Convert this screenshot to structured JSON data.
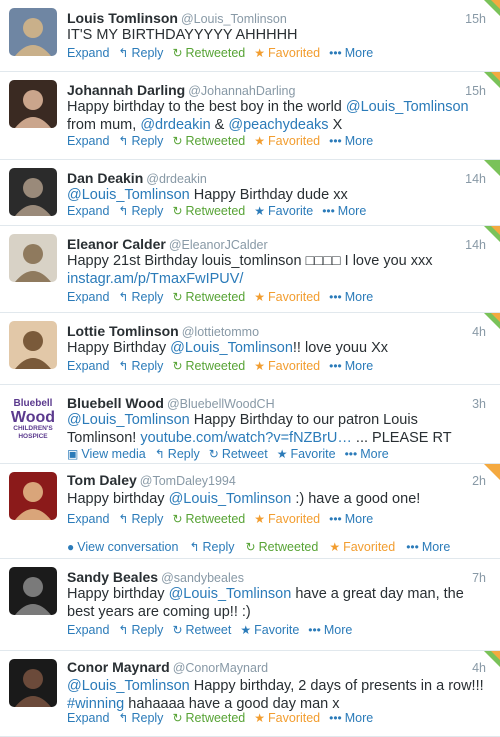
{
  "tweets": [
    {
      "name": "Louis Tomlinson",
      "handle": "@Louis_Tomlinson",
      "time": "15h",
      "text": [
        {
          "t": "IT'S MY BIRTHDAYYYYY AHHHHH"
        }
      ],
      "actions": [
        "Expand",
        "Reply",
        "Retweeted",
        "Favorited",
        "More"
      ],
      "corner": "green-orange"
    },
    {
      "name": "Johannah Darling",
      "handle": "@JohannahDarling",
      "time": "15h",
      "text": [
        {
          "t": "Happy birthday to the best boy in the world "
        },
        {
          "t": "@Louis_Tomlinson",
          "link": true
        },
        {
          "t": " from mum, "
        },
        {
          "t": "@drdeakin",
          "link": true
        },
        {
          "t": " & "
        },
        {
          "t": "@peachydeaks",
          "link": true
        },
        {
          "t": " X"
        }
      ],
      "actions": [
        "Expand",
        "Reply",
        "Retweeted",
        "Favorited",
        "More"
      ],
      "corner": "green-orange"
    },
    {
      "name": "Dan Deakin",
      "handle": "@drdeakin",
      "time": "14h",
      "text": [
        {
          "t": "@Louis_Tomlinson",
          "link": true
        },
        {
          "t": " Happy Birthday dude xx"
        }
      ],
      "actions": [
        "Expand",
        "Reply",
        "Retweeted",
        "Favorite",
        "More"
      ],
      "corner": "green"
    },
    {
      "name": "Eleanor Calder",
      "handle": "@EleanorJCalder",
      "time": "14h",
      "text": [
        {
          "t": "Happy 21st Birthday louis_tomlinson □□□□ I love you xxx "
        },
        {
          "t": "instagr.am/p/TmaxFwIPUV/",
          "link": true
        }
      ],
      "actions": [
        "Expand",
        "Reply",
        "Retweeted",
        "Favorited",
        "More"
      ],
      "corner": "green-orange"
    },
    {
      "name": "Lottie Tomlinson",
      "handle": "@lottietommo",
      "time": "4h",
      "text": [
        {
          "t": "Happy Birthday "
        },
        {
          "t": "@Louis_Tomlinson",
          "link": true
        },
        {
          "t": "!! love youu Xx"
        }
      ],
      "actions": [
        "Expand",
        "Reply",
        "Retweeted",
        "Favorited",
        "More"
      ],
      "corner": "green-orange"
    },
    {
      "name": "Bluebell Wood",
      "handle": "@BluebellWoodCH",
      "time": "3h",
      "text": [
        {
          "t": "@Louis_Tomlinson",
          "link": true
        },
        {
          "t": " Happy Birthday to our patron Louis Tomlinson! "
        },
        {
          "t": "youtube.com/watch?v=fNZBrU…",
          "link": true
        },
        {
          "t": " ... PLEASE RT"
        }
      ],
      "actions": [
        "View media",
        "Reply",
        "Retweet",
        "Favorite",
        "More"
      ],
      "corner": "none",
      "logo": [
        "Bluebell",
        "Wood",
        "CHILDREN'S",
        "HOSPICE"
      ]
    },
    {
      "name": "Tom Daley",
      "handle": "@TomDaley1994",
      "time": "2h",
      "text": [
        {
          "t": "Happy birthday "
        },
        {
          "t": "@Louis_Tomlinson",
          "link": true
        },
        {
          "t": " :) have a good one!"
        }
      ],
      "actions": [
        "Expand",
        "Reply",
        "Retweeted",
        "Favorited",
        "More"
      ],
      "corner": "orange",
      "conversation": [
        "View conversation",
        "Reply",
        "Retweeted",
        "Favorited",
        "More"
      ]
    },
    {
      "name": "Sandy Beales",
      "handle": "@sandybeales",
      "time": "7h",
      "text": [
        {
          "t": "Happy birthday "
        },
        {
          "t": "@Louis_Tomlinson",
          "link": true
        },
        {
          "t": " have a great day man, the best years are coming up!! :)"
        }
      ],
      "actions": [
        "Expand",
        "Reply",
        "Retweet",
        "Favorite",
        "More"
      ],
      "corner": "none"
    },
    {
      "name": "Conor Maynard",
      "handle": "@ConorMaynard",
      "time": "4h",
      "text": [
        {
          "t": "@Louis_Tomlinson",
          "link": true
        },
        {
          "t": " Happy birthday, 2 days of presents in a row!!! "
        },
        {
          "t": "#winning",
          "link": true
        },
        {
          "t": " hahaaaa have a good day man x"
        }
      ],
      "actions": [
        "Expand",
        "Reply",
        "Retweeted",
        "Favorited",
        "More"
      ],
      "corner": "green-orange"
    }
  ],
  "colors": {
    "link": "#2b7bb9",
    "retweeted": "#57a335",
    "favorited": "#f29d2f",
    "meta": "#8899a6"
  },
  "icons": {
    "expand": "",
    "reply": "reply-arrow-icon",
    "retweet": "retweet-icon",
    "favorite": "star-icon",
    "more": "dots-icon",
    "media": "media-icon",
    "conversation": "speech-bubble-icon"
  }
}
